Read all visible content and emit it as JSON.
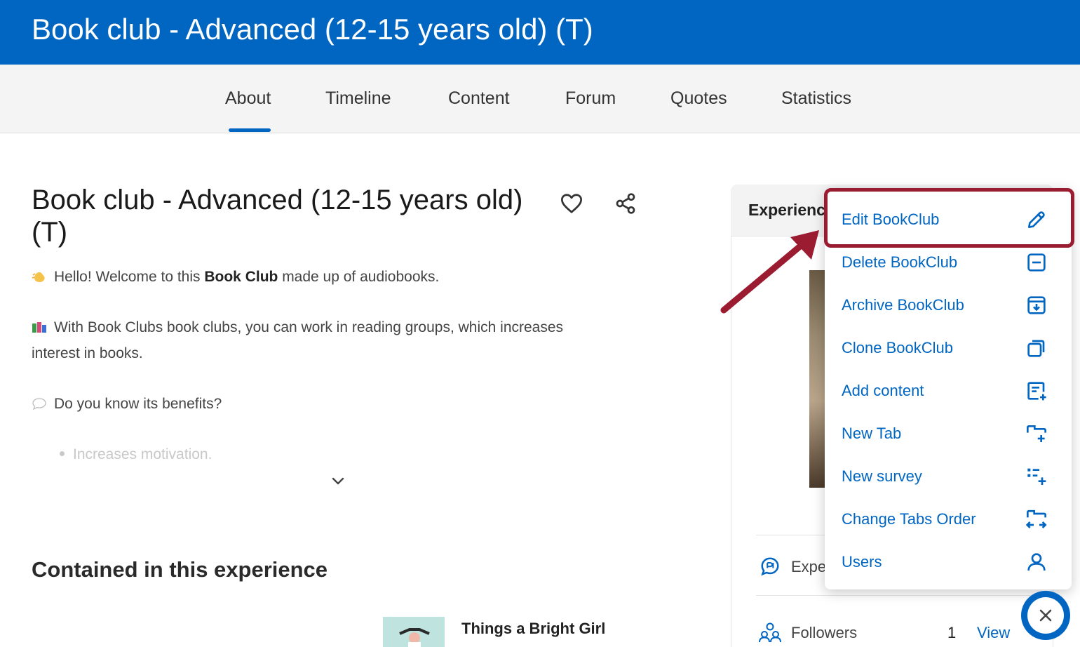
{
  "header": {
    "title": "Book club - Advanced (12-15 years old) (T)"
  },
  "tabs": [
    {
      "label": "About",
      "active": true
    },
    {
      "label": "Timeline"
    },
    {
      "label": "Content"
    },
    {
      "label": "Forum"
    },
    {
      "label": "Quotes"
    },
    {
      "label": "Statistics"
    }
  ],
  "main": {
    "title": "Book club - Advanced (12-15 years old) (T)",
    "desc1_before": "Hello! Welcome to this ",
    "desc1_bold": "Book Club",
    "desc1_after": " made up of audiobooks.",
    "desc2": "With Book Clubs book clubs, you can work in reading groups, which increases interest in books.",
    "desc3": "Do you know its benefits?",
    "bullet1": "Increases motivation.",
    "section_title": "Contained in this experience",
    "book_title": "Things a Bright Girl"
  },
  "sidebar": {
    "header_title": "Experienc",
    "row1_label": "Expe",
    "row2_label": "Followers",
    "row2_count": "1",
    "row2_link": "View"
  },
  "menu": {
    "items": [
      {
        "label": "Edit BookClub",
        "icon": "pencil-icon"
      },
      {
        "label": "Delete BookClub",
        "icon": "delete-icon"
      },
      {
        "label": "Archive BookClub",
        "icon": "archive-icon"
      },
      {
        "label": "Clone BookClub",
        "icon": "clone-icon"
      },
      {
        "label": "Add content",
        "icon": "add-content-icon"
      },
      {
        "label": "New Tab",
        "icon": "new-tab-icon"
      },
      {
        "label": "New survey",
        "icon": "new-survey-icon"
      },
      {
        "label": "Change Tabs Order",
        "icon": "reorder-tabs-icon"
      },
      {
        "label": "Users",
        "icon": "user-icon"
      }
    ]
  },
  "colors": {
    "brand": "#0066c2",
    "annotation": "#9b1b30"
  }
}
